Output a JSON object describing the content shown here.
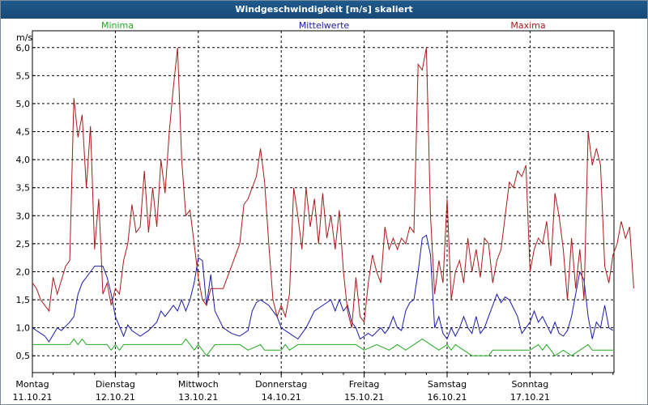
{
  "window": {
    "title": "Windgeschwindigkeit [m/s] skaliert"
  },
  "chart_data": {
    "type": "line",
    "title": "Windgeschwindigkeit [m/s] skaliert",
    "ylabel": "m/s",
    "ylim": [
      0.2,
      6.3
    ],
    "xlim": [
      0,
      7
    ],
    "yticks": [
      "0,5",
      "1,0",
      "1,5",
      "2,0",
      "2,5",
      "3,0",
      "3,5",
      "4,0",
      "4,5",
      "5,0",
      "5,5",
      "6,0"
    ],
    "ytick_values": [
      0.5,
      1.0,
      1.5,
      2.0,
      2.5,
      3.0,
      3.5,
      4.0,
      4.5,
      5.0,
      5.5,
      6.0
    ],
    "days": [
      {
        "name": "Montag",
        "date": "11.10.21"
      },
      {
        "name": "Dienstag",
        "date": "12.10.21"
      },
      {
        "name": "Mittwoch",
        "date": "13.10.21"
      },
      {
        "name": "Donnerstag",
        "date": "14.10.21"
      },
      {
        "name": "Freitag",
        "date": "15.10.21"
      },
      {
        "name": "Samstag",
        "date": "16.10.21"
      },
      {
        "name": "Sonntag",
        "date": "17.10.21"
      }
    ],
    "grid": true,
    "legend": "top",
    "series": [
      {
        "name": "Minima",
        "color": "#22aa22",
        "points": [
          [
            0,
            0.7
          ],
          [
            0.45,
            0.7
          ],
          [
            0.5,
            0.8
          ],
          [
            0.55,
            0.7
          ],
          [
            0.6,
            0.8
          ],
          [
            0.65,
            0.7
          ],
          [
            0.9,
            0.7
          ],
          [
            0.95,
            0.6
          ],
          [
            1.0,
            0.7
          ],
          [
            1.05,
            0.6
          ],
          [
            1.1,
            0.7
          ],
          [
            1.8,
            0.7
          ],
          [
            1.85,
            0.8
          ],
          [
            1.9,
            0.7
          ],
          [
            1.95,
            0.6
          ],
          [
            2.0,
            0.7
          ],
          [
            2.1,
            0.5
          ],
          [
            2.2,
            0.7
          ],
          [
            2.5,
            0.7
          ],
          [
            2.6,
            0.6
          ],
          [
            2.75,
            0.7
          ],
          [
            2.8,
            0.6
          ],
          [
            3.0,
            0.6
          ],
          [
            3.05,
            0.7
          ],
          [
            3.1,
            0.6
          ],
          [
            3.2,
            0.7
          ],
          [
            3.9,
            0.7
          ],
          [
            4.0,
            0.6
          ],
          [
            4.15,
            0.7
          ],
          [
            4.3,
            0.6
          ],
          [
            4.4,
            0.7
          ],
          [
            4.5,
            0.6
          ],
          [
            4.6,
            0.7
          ],
          [
            4.7,
            0.8
          ],
          [
            4.8,
            0.7
          ],
          [
            4.9,
            0.6
          ],
          [
            5.0,
            0.7
          ],
          [
            5.05,
            0.6
          ],
          [
            5.1,
            0.7
          ],
          [
            5.2,
            0.6
          ],
          [
            5.3,
            0.5
          ],
          [
            5.5,
            0.5
          ],
          [
            5.55,
            0.6
          ],
          [
            6.0,
            0.6
          ],
          [
            6.1,
            0.7
          ],
          [
            6.15,
            0.6
          ],
          [
            6.2,
            0.7
          ],
          [
            6.3,
            0.5
          ],
          [
            6.4,
            0.6
          ],
          [
            6.5,
            0.5
          ],
          [
            6.6,
            0.6
          ],
          [
            6.7,
            0.7
          ],
          [
            6.75,
            0.6
          ],
          [
            7.0,
            0.6
          ]
        ]
      },
      {
        "name": "Mittelwerte",
        "color": "#1a1aaa",
        "points": [
          [
            0,
            1.0
          ],
          [
            0.15,
            0.85
          ],
          [
            0.2,
            0.75
          ],
          [
            0.3,
            1.0
          ],
          [
            0.35,
            0.95
          ],
          [
            0.45,
            1.1
          ],
          [
            0.5,
            1.2
          ],
          [
            0.55,
            1.6
          ],
          [
            0.6,
            1.8
          ],
          [
            0.65,
            1.9
          ],
          [
            0.7,
            2.0
          ],
          [
            0.75,
            2.1
          ],
          [
            0.85,
            2.1
          ],
          [
            0.9,
            1.9
          ],
          [
            0.95,
            1.6
          ],
          [
            1.0,
            1.2
          ],
          [
            1.1,
            0.85
          ],
          [
            1.15,
            1.05
          ],
          [
            1.2,
            0.95
          ],
          [
            1.25,
            0.9
          ],
          [
            1.3,
            0.85
          ],
          [
            1.4,
            0.95
          ],
          [
            1.5,
            1.1
          ],
          [
            1.55,
            1.3
          ],
          [
            1.6,
            1.2
          ],
          [
            1.7,
            1.4
          ],
          [
            1.75,
            1.3
          ],
          [
            1.8,
            1.5
          ],
          [
            1.85,
            1.3
          ],
          [
            1.9,
            1.5
          ],
          [
            1.95,
            1.8
          ],
          [
            2.0,
            2.25
          ],
          [
            2.05,
            2.2
          ],
          [
            2.1,
            1.4
          ],
          [
            2.15,
            1.95
          ],
          [
            2.2,
            1.3
          ],
          [
            2.3,
            1.0
          ],
          [
            2.4,
            0.9
          ],
          [
            2.5,
            0.85
          ],
          [
            2.6,
            0.95
          ],
          [
            2.65,
            1.3
          ],
          [
            2.7,
            1.45
          ],
          [
            2.75,
            1.5
          ],
          [
            2.85,
            1.4
          ],
          [
            2.9,
            1.3
          ],
          [
            2.95,
            1.2
          ],
          [
            3.0,
            1.0
          ],
          [
            3.1,
            0.9
          ],
          [
            3.2,
            0.8
          ],
          [
            3.25,
            0.9
          ],
          [
            3.3,
            1.0
          ],
          [
            3.4,
            1.3
          ],
          [
            3.5,
            1.4
          ],
          [
            3.6,
            1.5
          ],
          [
            3.65,
            1.3
          ],
          [
            3.7,
            1.5
          ],
          [
            3.75,
            1.3
          ],
          [
            3.8,
            1.4
          ],
          [
            3.85,
            1.1
          ],
          [
            3.9,
            1.0
          ],
          [
            3.95,
            0.8
          ],
          [
            4.05,
            0.9
          ],
          [
            4.1,
            0.85
          ],
          [
            4.2,
            1.0
          ],
          [
            4.25,
            0.9
          ],
          [
            4.3,
            1.0
          ],
          [
            4.35,
            1.2
          ],
          [
            4.4,
            1.0
          ],
          [
            4.45,
            0.95
          ],
          [
            4.5,
            1.3
          ],
          [
            4.55,
            1.45
          ],
          [
            4.6,
            1.5
          ],
          [
            4.65,
            2.0
          ],
          [
            4.7,
            2.6
          ],
          [
            4.75,
            2.65
          ],
          [
            4.8,
            2.3
          ],
          [
            4.85,
            1.0
          ],
          [
            4.9,
            1.2
          ],
          [
            4.95,
            0.9
          ],
          [
            5.0,
            0.8
          ],
          [
            5.05,
            1.0
          ],
          [
            5.1,
            0.85
          ],
          [
            5.15,
            1.0
          ],
          [
            5.2,
            1.2
          ],
          [
            5.25,
            1.0
          ],
          [
            5.3,
            0.9
          ],
          [
            5.35,
            1.2
          ],
          [
            5.4,
            0.9
          ],
          [
            5.45,
            1.0
          ],
          [
            5.5,
            1.2
          ],
          [
            5.55,
            1.4
          ],
          [
            5.6,
            1.6
          ],
          [
            5.65,
            1.45
          ],
          [
            5.7,
            1.55
          ],
          [
            5.75,
            1.5
          ],
          [
            5.8,
            1.35
          ],
          [
            5.85,
            1.2
          ],
          [
            5.9,
            0.9
          ],
          [
            5.95,
            1.0
          ],
          [
            6.0,
            1.1
          ],
          [
            6.05,
            1.3
          ],
          [
            6.1,
            1.1
          ],
          [
            6.15,
            1.2
          ],
          [
            6.2,
            1.05
          ],
          [
            6.25,
            0.9
          ],
          [
            6.3,
            1.1
          ],
          [
            6.35,
            0.9
          ],
          [
            6.4,
            0.85
          ],
          [
            6.45,
            0.95
          ],
          [
            6.5,
            1.2
          ],
          [
            6.55,
            1.6
          ],
          [
            6.6,
            2.0
          ],
          [
            6.65,
            1.85
          ],
          [
            6.7,
            1.2
          ],
          [
            6.75,
            0.8
          ],
          [
            6.8,
            1.1
          ],
          [
            6.85,
            1.0
          ],
          [
            6.9,
            1.4
          ],
          [
            6.95,
            1.0
          ],
          [
            7.0,
            0.95
          ]
        ]
      },
      {
        "name": "Maxima",
        "color": "#aa1a1a",
        "points": [
          [
            0,
            1.8
          ],
          [
            0.05,
            1.7
          ],
          [
            0.1,
            1.5
          ],
          [
            0.2,
            1.3
          ],
          [
            0.25,
            1.9
          ],
          [
            0.3,
            1.6
          ],
          [
            0.4,
            2.1
          ],
          [
            0.45,
            2.2
          ],
          [
            0.5,
            5.1
          ],
          [
            0.55,
            4.4
          ],
          [
            0.6,
            4.8
          ],
          [
            0.65,
            3.5
          ],
          [
            0.7,
            4.6
          ],
          [
            0.75,
            2.4
          ],
          [
            0.8,
            3.3
          ],
          [
            0.85,
            1.6
          ],
          [
            0.9,
            1.8
          ],
          [
            0.95,
            1.4
          ],
          [
            1.0,
            1.7
          ],
          [
            1.05,
            1.6
          ],
          [
            1.1,
            2.2
          ],
          [
            1.15,
            2.5
          ],
          [
            1.2,
            3.2
          ],
          [
            1.25,
            2.7
          ],
          [
            1.3,
            2.8
          ],
          [
            1.35,
            3.8
          ],
          [
            1.4,
            2.7
          ],
          [
            1.45,
            3.5
          ],
          [
            1.5,
            2.8
          ],
          [
            1.55,
            4.0
          ],
          [
            1.6,
            3.4
          ],
          [
            1.65,
            4.5
          ],
          [
            1.7,
            5.3
          ],
          [
            1.75,
            6.0
          ],
          [
            1.8,
            4.0
          ],
          [
            1.85,
            3.0
          ],
          [
            1.9,
            3.1
          ],
          [
            1.95,
            2.5
          ],
          [
            2.0,
            1.9
          ],
          [
            2.05,
            1.5
          ],
          [
            2.1,
            1.4
          ],
          [
            2.15,
            1.7
          ],
          [
            2.3,
            1.7
          ],
          [
            2.4,
            2.1
          ],
          [
            2.5,
            2.5
          ],
          [
            2.55,
            3.2
          ],
          [
            2.6,
            3.3
          ],
          [
            2.7,
            3.7
          ],
          [
            2.75,
            4.2
          ],
          [
            2.8,
            3.6
          ],
          [
            2.85,
            2.5
          ],
          [
            2.9,
            1.5
          ],
          [
            2.95,
            1.2
          ],
          [
            3.0,
            1.4
          ],
          [
            3.05,
            1.2
          ],
          [
            3.1,
            1.6
          ],
          [
            3.15,
            3.5
          ],
          [
            3.2,
            3.0
          ],
          [
            3.25,
            2.4
          ],
          [
            3.3,
            3.5
          ],
          [
            3.35,
            2.8
          ],
          [
            3.4,
            3.3
          ],
          [
            3.45,
            2.5
          ],
          [
            3.5,
            3.4
          ],
          [
            3.55,
            2.6
          ],
          [
            3.6,
            3.0
          ],
          [
            3.65,
            2.4
          ],
          [
            3.7,
            3.1
          ],
          [
            3.75,
            2.0
          ],
          [
            3.8,
            1.3
          ],
          [
            3.85,
            1.0
          ],
          [
            3.9,
            1.9
          ],
          [
            3.95,
            1.2
          ],
          [
            4.0,
            1.1
          ],
          [
            4.05,
            1.8
          ],
          [
            4.1,
            2.3
          ],
          [
            4.15,
            2.0
          ],
          [
            4.2,
            1.8
          ],
          [
            4.25,
            2.8
          ],
          [
            4.3,
            2.4
          ],
          [
            4.35,
            2.6
          ],
          [
            4.4,
            2.4
          ],
          [
            4.45,
            2.6
          ],
          [
            4.5,
            2.5
          ],
          [
            4.55,
            2.8
          ],
          [
            4.6,
            2.7
          ],
          [
            4.65,
            5.7
          ],
          [
            4.7,
            5.6
          ],
          [
            4.75,
            6.0
          ],
          [
            4.8,
            3.0
          ],
          [
            4.85,
            1.6
          ],
          [
            4.9,
            2.2
          ],
          [
            4.95,
            1.8
          ],
          [
            5.0,
            3.3
          ],
          [
            5.05,
            1.5
          ],
          [
            5.1,
            2.0
          ],
          [
            5.15,
            2.2
          ],
          [
            5.2,
            1.8
          ],
          [
            5.25,
            2.6
          ],
          [
            5.3,
            2.0
          ],
          [
            5.35,
            2.4
          ],
          [
            5.4,
            1.9
          ],
          [
            5.45,
            2.6
          ],
          [
            5.5,
            2.5
          ],
          [
            5.55,
            1.8
          ],
          [
            5.6,
            2.2
          ],
          [
            5.65,
            2.4
          ],
          [
            5.7,
            3.0
          ],
          [
            5.75,
            3.6
          ],
          [
            5.8,
            3.5
          ],
          [
            5.85,
            3.8
          ],
          [
            5.9,
            3.7
          ],
          [
            5.95,
            3.9
          ],
          [
            6.0,
            2.0
          ],
          [
            6.05,
            2.4
          ],
          [
            6.1,
            2.6
          ],
          [
            6.15,
            2.5
          ],
          [
            6.2,
            2.9
          ],
          [
            6.25,
            2.1
          ],
          [
            6.3,
            3.4
          ],
          [
            6.35,
            3.0
          ],
          [
            6.4,
            2.4
          ],
          [
            6.45,
            1.5
          ],
          [
            6.5,
            2.6
          ],
          [
            6.55,
            1.7
          ],
          [
            6.6,
            2.4
          ],
          [
            6.65,
            1.5
          ],
          [
            6.7,
            4.5
          ],
          [
            6.75,
            3.9
          ],
          [
            6.8,
            4.2
          ],
          [
            6.85,
            3.9
          ],
          [
            6.9,
            2.1
          ],
          [
            6.95,
            1.8
          ],
          [
            7.0,
            2.3
          ],
          [
            7.05,
            2.5
          ],
          [
            7.1,
            2.9
          ],
          [
            7.15,
            2.6
          ],
          [
            7.2,
            2.8
          ],
          [
            7.25,
            1.7
          ]
        ]
      }
    ]
  }
}
